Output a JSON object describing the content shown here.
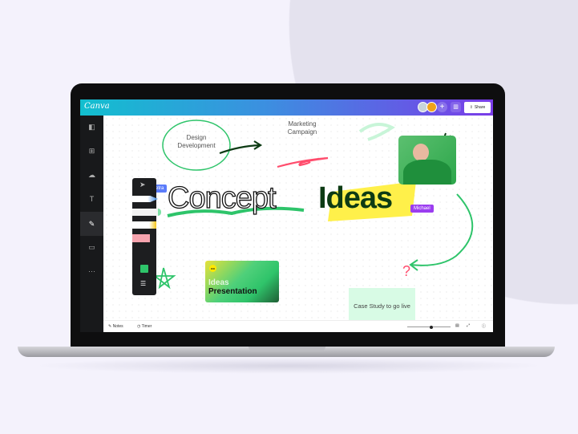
{
  "app": {
    "logo": "Canva",
    "share_label": "Share",
    "add_icon": "+"
  },
  "sidebar": {
    "items": [
      {
        "icon": "layout-icon",
        "glyph": "◧"
      },
      {
        "icon": "elements-icon",
        "glyph": "⊞"
      },
      {
        "icon": "upload-icon",
        "glyph": "☁"
      },
      {
        "icon": "text-icon",
        "glyph": "T"
      },
      {
        "icon": "draw-icon",
        "glyph": "✎"
      },
      {
        "icon": "projects-icon",
        "glyph": "▭"
      },
      {
        "icon": "more-icon",
        "glyph": "···"
      }
    ]
  },
  "canvas": {
    "bubble_text": "Design Development",
    "marketing_text": "Marketing Campaign",
    "headline_outline": "Concept",
    "headline_bold": "Ideas",
    "cursor_petra": "Petra",
    "cursor_michael": "Michael",
    "card_line1": "Ideas",
    "card_line2": "Presentation",
    "card_badge": "co",
    "sticky_text": "Case Study to go live",
    "question_mark": "?",
    "colors": {
      "green": "#2ec46a",
      "pink": "#ff4d6d",
      "yellow": "#fff04a",
      "petra": "#5b7cfa",
      "michael": "#9b3df0",
      "dark_green": "#0d3b14"
    }
  },
  "footer": {
    "notes": "Notes",
    "timer": "Timer",
    "zoom_fraction": 0.55
  }
}
